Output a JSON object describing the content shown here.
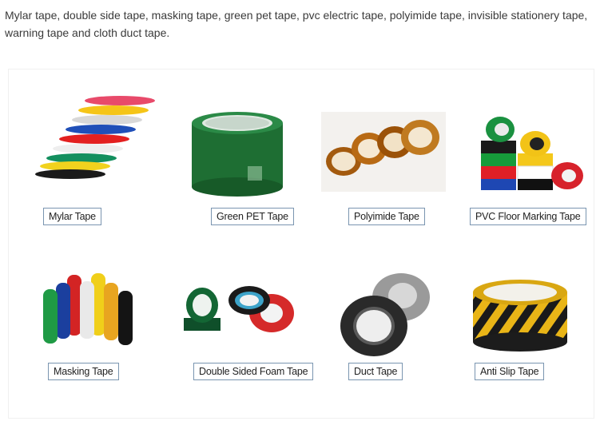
{
  "intro": "Mylar tape, double side tape, masking tape, green pet tape, pvc electric tape, polyimide tape, invisible stationery tape, warning tape and cloth duct tape.",
  "products": [
    {
      "name": "Mylar Tape"
    },
    {
      "name": "Green PET Tape"
    },
    {
      "name": "Polyimide Tape"
    },
    {
      "name": "PVC Floor Marking Tape"
    },
    {
      "name": "Masking Tape"
    },
    {
      "name": "Double Sided Foam Tape"
    },
    {
      "name": "Duct Tape"
    },
    {
      "name": "Anti Slip Tape"
    }
  ]
}
